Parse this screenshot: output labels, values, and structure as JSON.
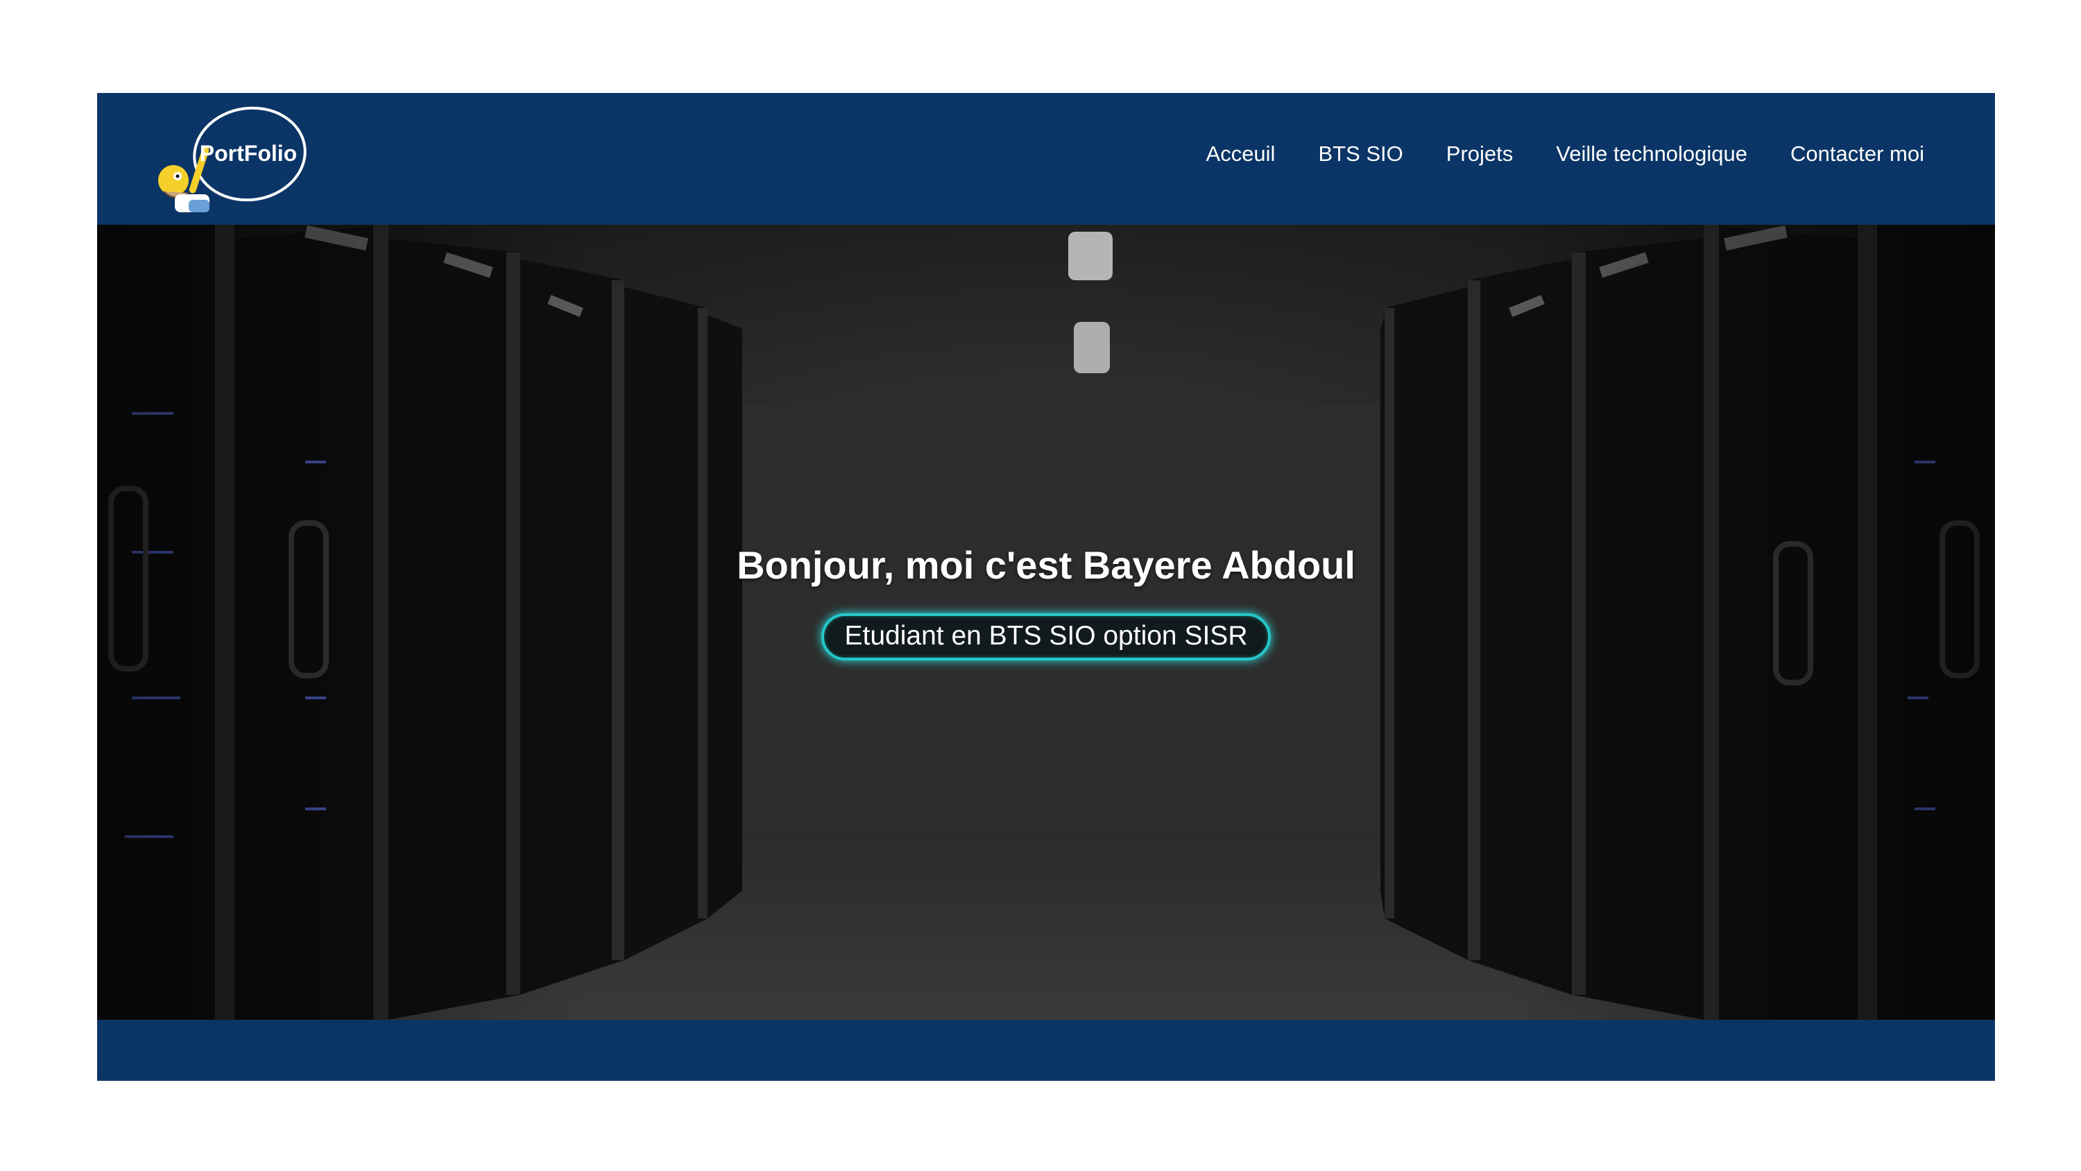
{
  "header": {
    "logo_text": "PortFolio",
    "nav": [
      {
        "label": "Acceuil"
      },
      {
        "label": "BTS SIO"
      },
      {
        "label": "Projets"
      },
      {
        "label": "Veille technologique"
      },
      {
        "label": "Contacter moi"
      }
    ]
  },
  "hero": {
    "title": "Bonjour, moi c'est Bayere Abdoul",
    "subtitle": "Etudiant en BTS SIO option SISR",
    "background": "server-room-image"
  },
  "colors": {
    "brand": "#0b3566",
    "accent": "#25c7c7"
  }
}
